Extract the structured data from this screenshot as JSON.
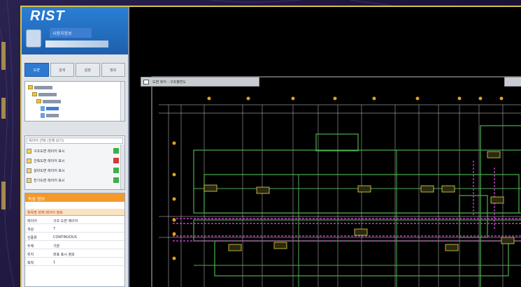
{
  "app": {
    "logo_text": "RIST",
    "user_label": "사용자정보"
  },
  "sidebar": {
    "tabs": [
      {
        "label": "도면",
        "active": true
      },
      {
        "label": "검색",
        "active": false
      },
      {
        "label": "설정",
        "active": false
      },
      {
        "label": "정보",
        "active": false
      }
    ],
    "layer_filter_value": "레이어 선택 (전체 보기)",
    "layers": [
      {
        "name": "구조도면 레이어 표시",
        "color": "#3cb04a"
      },
      {
        "name": "건축도면 레이어 표시",
        "color": "#d23a3a"
      },
      {
        "name": "설비도면 레이어 표시",
        "color": "#3cb04a"
      },
      {
        "name": "전기도면 레이어 표시",
        "color": "#3cb04a"
      }
    ],
    "props_title": "속성 정보",
    "props_header": "항목명    현재 레이어 정보",
    "properties": [
      {
        "key": "레이어",
        "value": "구조 도면 레이어"
      },
      {
        "key": "색상",
        "value": "7"
      },
      {
        "key": "선종류",
        "value": "CONTINUOUS"
      },
      {
        "key": "두께",
        "value": "기본"
      },
      {
        "key": "위치",
        "value": "좌표 표시 정보"
      },
      {
        "key": "축척",
        "value": "1"
      }
    ]
  },
  "canvas": {
    "tab_label": "도면 뷰어 - 구조평면도"
  },
  "colors": {
    "accent": "#2e7ad0",
    "frame": "#d8c24a",
    "cad_green": "#4caf50",
    "cad_magenta": "#c040c0",
    "cad_label": "#e8d84a",
    "props_orange": "#f39a2a"
  }
}
